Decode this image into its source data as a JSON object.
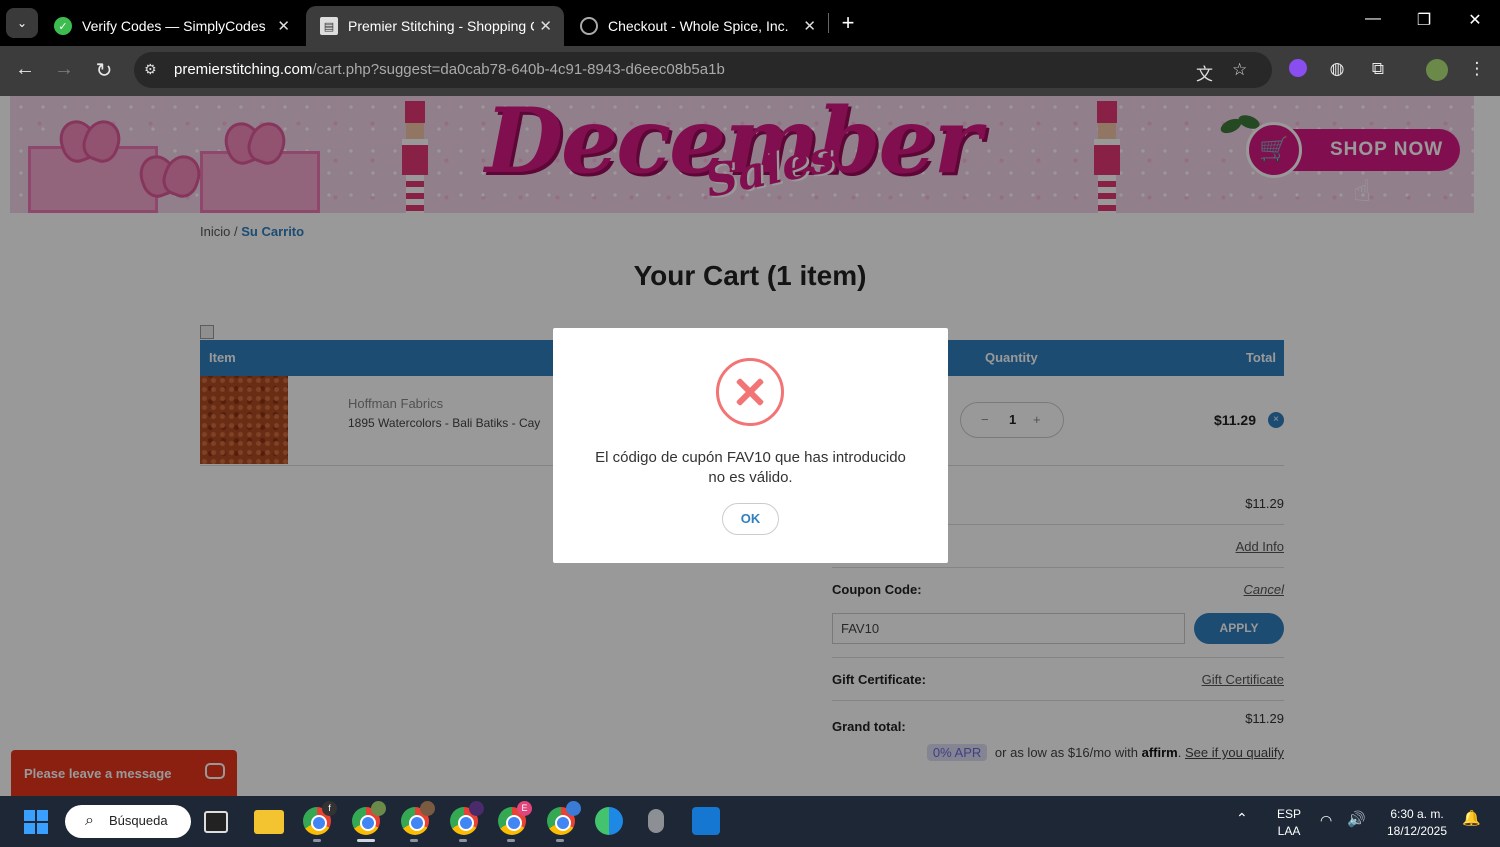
{
  "browser": {
    "tabs": [
      {
        "title": "Verify Codes — SimplyCodes",
        "favicon": "simplycodes-icon",
        "close": "✕"
      },
      {
        "title": "Premier Stitching - Shopping Ca",
        "favicon": "page-icon",
        "close": "✕"
      },
      {
        "title": "Checkout - Whole Spice, Inc.",
        "favicon": "globe-icon",
        "close": "✕"
      }
    ],
    "tab_menu": "⌄",
    "new_tab": "+",
    "url_host": "premierstitching.com",
    "url_rest": "/cart.php?suggest=da0cab78-640b-4c91-8943-d6eec08b5a1b"
  },
  "banner": {
    "title": "December",
    "subtitle": "Sales",
    "cta": "SHOP NOW"
  },
  "breadcrumb": {
    "home": "Inicio",
    "sep": "/",
    "current": "Su Carrito"
  },
  "page_title": "Your Cart (1 item)",
  "cart": {
    "headers": {
      "item": "Item",
      "quantity": "Quantity",
      "total": "Total"
    },
    "item": {
      "brand": "Hoffman Fabrics",
      "name": "1895 Watercolors - Bali Batiks - Cay",
      "quantity": "1",
      "minus": "−",
      "plus": "+",
      "total": "$11.29",
      "remove": "×"
    }
  },
  "summary": {
    "subtotal_value": "$11.29",
    "add_info": "Add Info",
    "coupon_label": "Coupon Code:",
    "coupon_cancel": "Cancel",
    "coupon_value": "FAV10",
    "apply": "APPLY",
    "gift_label": "Gift Certificate:",
    "gift_link": "Gift Certificate",
    "grand_label": "Grand total:",
    "grand_value": "$11.29",
    "affirm_apr": "0% APR",
    "affirm_text": "or as low as $16/mo with",
    "affirm_brand": "affirm",
    "affirm_link": "See if you qualify"
  },
  "chat": {
    "label": "Please leave a message"
  },
  "modal": {
    "message": "El código de cupón FAV10 que has introducido no es válido.",
    "ok": "OK"
  },
  "taskbar": {
    "search": "Búsqueda",
    "lang_top": "ESP",
    "lang_bottom": "LAA",
    "time": "6:30 a. m.",
    "date": "18/12/2025"
  },
  "colors": {
    "accent_blue": "#2f7fbf",
    "banner_pink": "#d81a85",
    "error_red": "#f27474",
    "chat_orange": "#e8351b"
  }
}
